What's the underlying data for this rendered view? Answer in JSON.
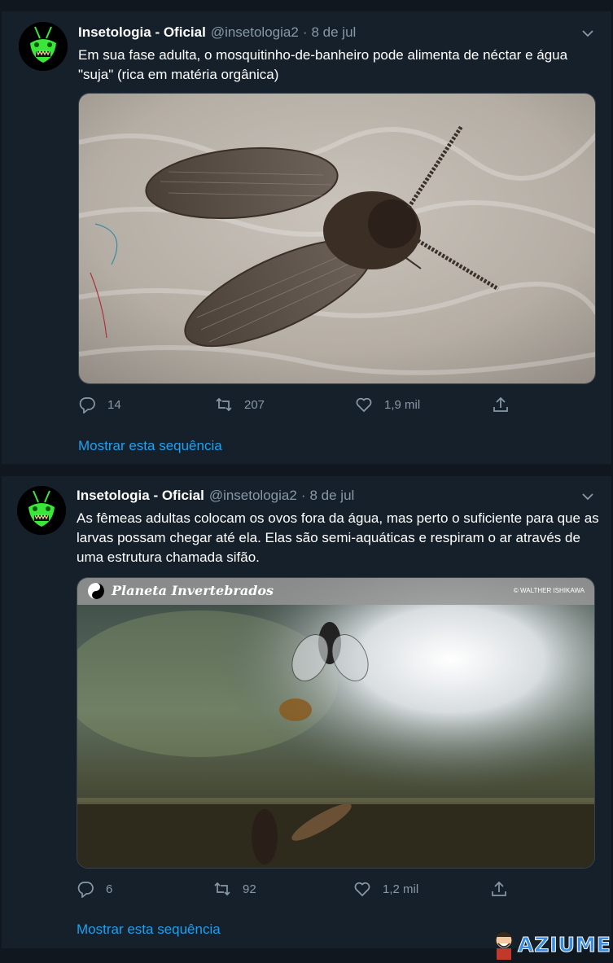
{
  "tweets": [
    {
      "name": "Insetologia - Oficial",
      "handle": "@insetologia2",
      "separator": "·",
      "date": "8 de jul",
      "text": "Em sua fase adulta, o mosquitinho-de-banheiro pode alimenta de néctar e água \"suja\" (rica em matéria orgânica)",
      "image_overlay_text": "",
      "image_credit": "",
      "replies": "14",
      "retweets": "207",
      "likes": "1,9 mil",
      "show_thread": "Mostrar esta sequência"
    },
    {
      "name": "Insetologia - Oficial",
      "handle": "@insetologia2",
      "separator": "·",
      "date": "8 de jul",
      "text": "As fêmeas adultas colocam os ovos fora da água, mas perto o suficiente para que as larvas possam chegar até ela. Elas são semi-aquáticas e respiram o ar através de uma estrutura chamada sifão.",
      "image_overlay_text": "Planeta Invertebrados",
      "image_credit": "© WALTHER ISHIKAWA",
      "replies": "6",
      "retweets": "92",
      "likes": "1,2 mil",
      "show_thread": "Mostrar esta sequência"
    }
  ],
  "watermark": {
    "text": "AZIUME"
  },
  "colors": {
    "background": "#10171e",
    "card": "#15202b",
    "text": "#ffffff",
    "muted": "#8899a6",
    "link": "#1da1f2",
    "avatar_accent": "#39e639"
  },
  "icons": [
    "reply-icon",
    "retweet-icon",
    "like-icon",
    "share-icon",
    "chevron-down-icon"
  ]
}
